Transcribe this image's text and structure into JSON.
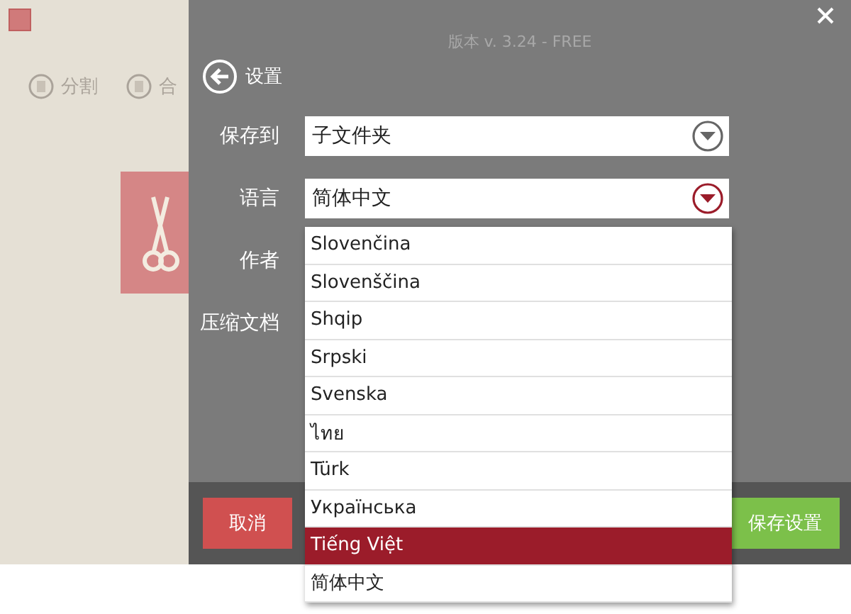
{
  "app": {
    "toolbar": [
      {
        "label": "分割"
      },
      {
        "label": "合"
      }
    ]
  },
  "settings": {
    "version": "版本 v. 3.24 - FREE",
    "title": "设置",
    "fields": [
      {
        "label": "保存到",
        "value": "子文件夹",
        "open": false
      },
      {
        "label": "语言",
        "value": "简体中文",
        "open": true
      },
      {
        "label": "作者"
      },
      {
        "label": "压缩文档"
      }
    ],
    "language_options": [
      {
        "label": "Slovenčina",
        "selected": false
      },
      {
        "label": "Slovenščina",
        "selected": false
      },
      {
        "label": "Shqip",
        "selected": false
      },
      {
        "label": "Srpski",
        "selected": false
      },
      {
        "label": "Svenska",
        "selected": false
      },
      {
        "label": "ไทย",
        "selected": false
      },
      {
        "label": "Türk",
        "selected": false
      },
      {
        "label": "Українська",
        "selected": false
      },
      {
        "label": "Tiếng Việt",
        "selected": true
      },
      {
        "label": "简体中文",
        "selected": false
      }
    ],
    "buttons": {
      "cancel": "取消",
      "save": "保存设置"
    }
  }
}
